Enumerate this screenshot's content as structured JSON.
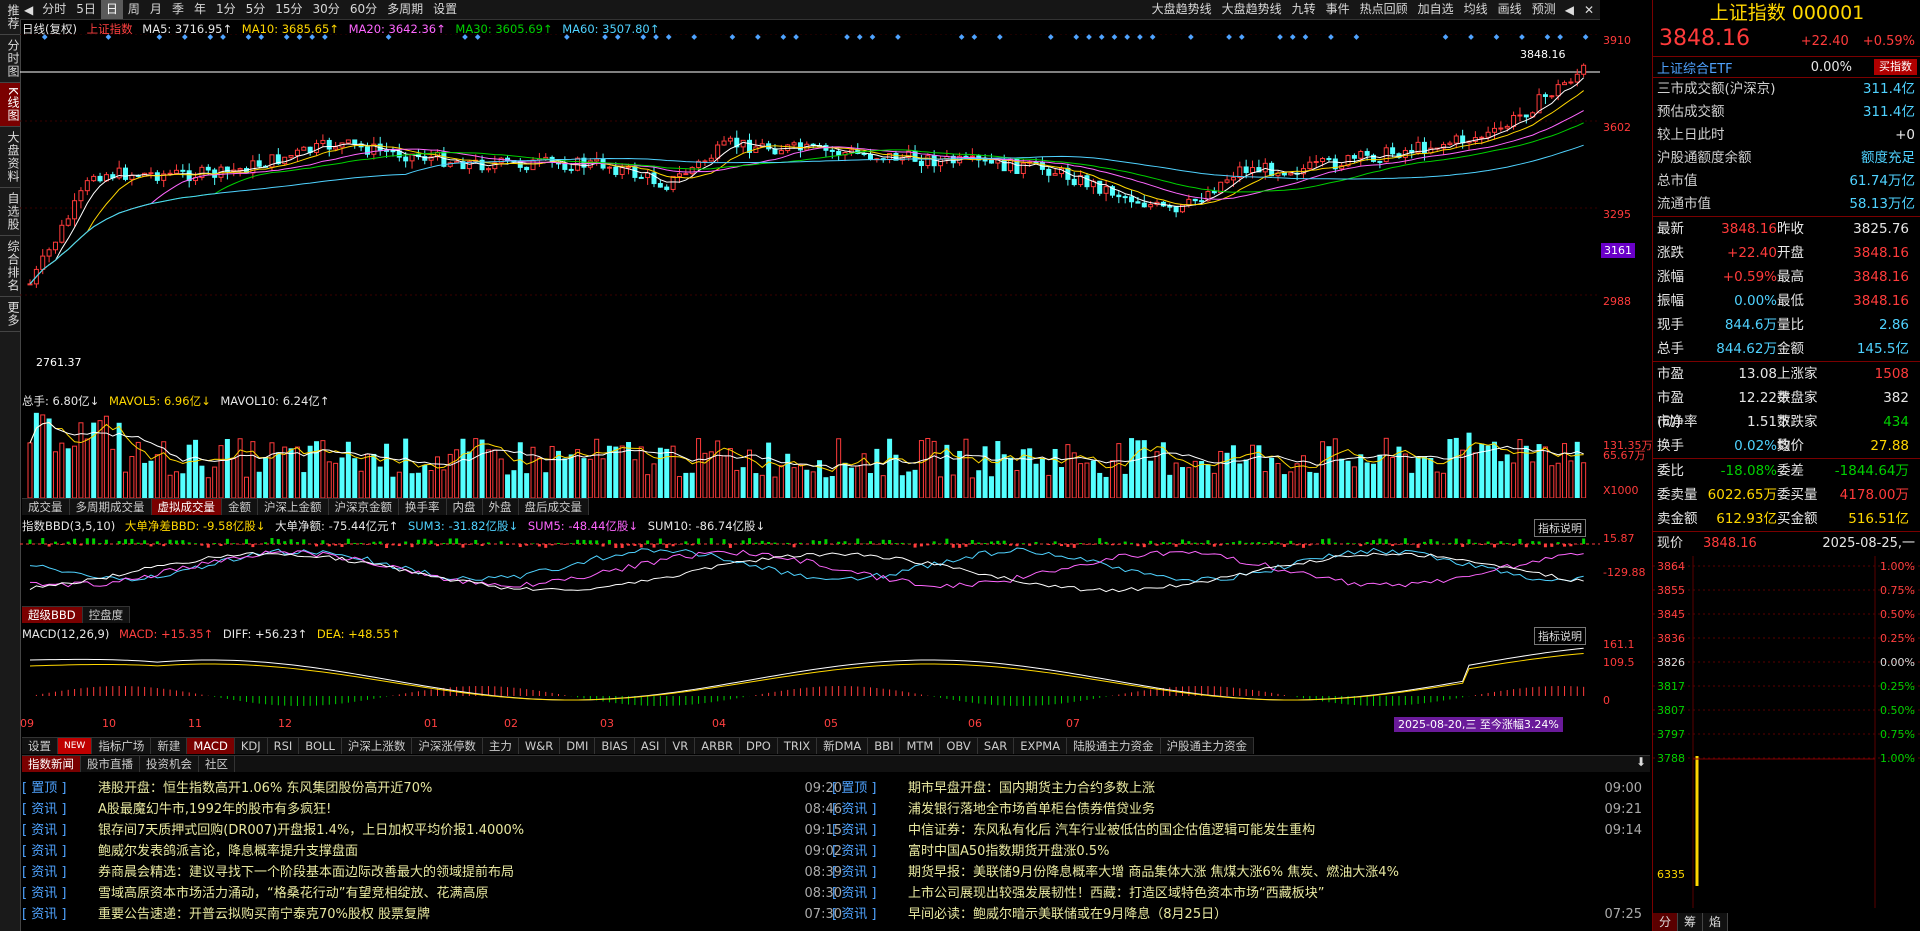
{
  "sidebar": {
    "tabs": [
      "推荐",
      "分时图",
      "K线图",
      "大盘资料",
      "自选股",
      "综合排名",
      "更多"
    ],
    "active": 2
  },
  "toolbar": {
    "left": [
      "分时",
      "5日",
      "日",
      "周",
      "月",
      "季",
      "年",
      "1分",
      "5分",
      "15分",
      "30分",
      "60分",
      "多周期",
      "设置"
    ],
    "selected": 2,
    "right": [
      "大盘趋势线",
      "大盘趋势线",
      "九转",
      "事件",
      "热点回顾",
      "加自选",
      "均线",
      "画线",
      "预测"
    ]
  },
  "kline": {
    "legend": {
      "title": "日线(复权)",
      "name": "上证指数",
      "ma5": "MA5: 3716.95↑",
      "ma10": "MA10: 3685.65↑",
      "ma20": "MA20: 3642.36↑",
      "ma30": "MA30: 3605.69↑",
      "ma60": "MA60: 3507.80↑"
    },
    "yticks": [
      "3910",
      "3602",
      "3295",
      "2988"
    ],
    "current_price_label": "3161",
    "high_label": "3848.16",
    "low_label": "2761.37"
  },
  "volume": {
    "legend": {
      "total": "总手: 6.80亿↓",
      "mavol5": "MAVOL5: 6.96亿↓",
      "mavol10": "MAVOL10: 6.24亿↑"
    },
    "yticks": [
      "131.35万",
      "65.67万"
    ],
    "unit": "X1000",
    "tabs": [
      "成交量",
      "多周期成交量",
      "虚拟成交量",
      "金额",
      "沪深上金额",
      "沪深京金额",
      "换手率",
      "内盘",
      "外盘",
      "盘后成交量"
    ],
    "selected": 2
  },
  "bbd": {
    "legend": {
      "title": "指数BBD(3,5,10)",
      "big": "大单净差BBD: -9.58亿股↓",
      "net": "大单净额: -75.44亿元↑",
      "sum3": "SUM3: -31.82亿股↓",
      "sum5": "SUM5: -48.44亿股↓",
      "sum10": "SUM10: -86.74亿股↓"
    },
    "yticks": [
      "15.87",
      "-129.88"
    ],
    "explain": "指标说明",
    "tabs": [
      "超级BBD",
      "控盘度"
    ],
    "selected": 0
  },
  "macd": {
    "legend": {
      "title": "MACD(12,26,9)",
      "macd": "MACD: +15.35↑",
      "diff": "DIFF: +56.23↑",
      "dea": "DEA: +48.55↑"
    },
    "yticks": [
      "161.1",
      "109.5",
      "0"
    ],
    "explain": "指标说明",
    "months": [
      "09",
      "10",
      "11",
      "12",
      "01",
      "02",
      "03",
      "04",
      "05",
      "06",
      "07"
    ],
    "range_label": "2025-08-20,三 至今涨幅3.24%"
  },
  "indicator_tabs": [
    "设置",
    "NEW",
    "指标广场",
    "新建",
    "MACD",
    "KDJ",
    "RSI",
    "BOLL",
    "沪深上涨数",
    "沪深涨停数",
    "主力",
    "W&R",
    "DMI",
    "BIAS",
    "ASI",
    "VR",
    "ARBR",
    "DPO",
    "TRIX",
    "新DMA",
    "BBI",
    "MTM",
    "OBV",
    "SAR",
    "EXPMA",
    "陆股通主力资金",
    "沪股通主力资金"
  ],
  "news": {
    "tabs": [
      "指数新闻",
      "股市直播",
      "投资机会",
      "社区"
    ],
    "left": [
      {
        "tag": "置顶",
        "title": "港股开盘：恒生指数高开1.06% 东风集团股份高开近70%",
        "time": "09:20"
      },
      {
        "tag": "资讯",
        "title": "A股最魔幻牛市,1992年的股市有多疯狂!",
        "time": "08:46"
      },
      {
        "tag": "资讯",
        "title": "银存间7天质押式回购(DR007)开盘报1.4%，上日加权平均价报1.4000%",
        "time": "09:15"
      },
      {
        "tag": "资讯",
        "title": "鲍威尔发表鸽派言论，降息概率提升支撑盘面",
        "time": "09:02"
      },
      {
        "tag": "资讯",
        "title": "券商晨会精选：建议寻找下一个阶段基本面边际改善最大的领域提前布局",
        "time": "08:39"
      },
      {
        "tag": "资讯",
        "title": "雪域高原资本市场活力涌动，“格桑花行动”有望竞相绽放、花满高原",
        "time": "08:30"
      },
      {
        "tag": "资讯",
        "title": "重要公告速递：开普云拟购买南宁泰克70%股权 股票复牌",
        "time": "07:30"
      }
    ],
    "right": [
      {
        "tag": "置顶",
        "title": "期市早盘开盘：国内期货主力合约多数上涨",
        "time": "09:00"
      },
      {
        "tag": "资讯",
        "title": "浦发银行落地全市场首单柜台债券借贷业务",
        "time": "09:21"
      },
      {
        "tag": "资讯",
        "title": "中信证券：东风私有化后 汽车行业被低估的国企估值逻辑可能发生重构",
        "time": "09:14"
      },
      {
        "tag": "资讯",
        "title": "富时中国A50指数期货开盘涨0.5%",
        "time": ""
      },
      {
        "tag": "资讯",
        "title": "期货早报：美联储9月份降息概率大增 商品集体大涨 焦煤大涨6% 焦炭、燃油大涨4%",
        "time": ""
      },
      {
        "tag": "资讯",
        "title": "上市公司展现出较强发展韧性！西藏：打造区域特色资本市场“西藏板块”",
        "time": ""
      },
      {
        "tag": "资讯",
        "title": "早间必读：鲍威尔暗示美联储或在9月降息（8月25日）",
        "time": "07:25"
      }
    ]
  },
  "quote": {
    "name": "上证指数 000001",
    "price": "3848.16",
    "change": "+22.40",
    "pct": "+0.59%",
    "etf": "上证综合ETF",
    "etf_pct": "0.00%",
    "buy_btn": "买指数",
    "rows1": [
      {
        "k": "三市成交额(沪深京)",
        "v": "311.4亿"
      },
      {
        "k": "预估成交额",
        "v": "311.4亿"
      },
      {
        "k": "较上日此时",
        "v": "+0"
      },
      {
        "k": "沪股通额度余额",
        "v": "额度充足"
      },
      {
        "k": "总市值",
        "v": "61.74万亿"
      },
      {
        "k": "流通市值",
        "v": "58.13万亿"
      }
    ],
    "rows2": [
      [
        "最新",
        "3848.16",
        "昨收",
        "3825.76"
      ],
      [
        "涨跌",
        "+22.40",
        "开盘",
        "3848.16"
      ],
      [
        "涨幅",
        "+0.59%",
        "最高",
        "3848.16"
      ],
      [
        "振幅",
        "0.00%",
        "最低",
        "3848.16"
      ],
      [
        "现手",
        "844.6万",
        "量比",
        "2.86"
      ],
      [
        "总手",
        "844.62万",
        "金额",
        "145.5亿"
      ]
    ],
    "rows3": [
      [
        "市盈",
        "13.08",
        "上涨家数",
        "1508"
      ],
      [
        "市盈(动)",
        "12.22",
        "平盘家数",
        "382"
      ],
      [
        "市净率",
        "1.51",
        "下跌家数",
        "434"
      ],
      [
        "换手",
        "0.02%",
        "均价",
        "27.88"
      ]
    ],
    "rows4": [
      [
        "委比",
        "-18.08%",
        "委差",
        "-1844.64万"
      ],
      [
        "委卖量",
        "6022.65万",
        "委买量",
        "4178.00万"
      ],
      [
        "卖金额",
        "612.93亿",
        "买金额",
        "516.51亿"
      ]
    ],
    "now_label": "现价",
    "now_val": "3848.16",
    "date": "2025-08-25,一",
    "mini_left": [
      "3864",
      "3855",
      "3845",
      "3836",
      "3826",
      "3817",
      "3807",
      "3797",
      "3788",
      "6335"
    ],
    "mini_right": [
      "1.00%",
      "0.75%",
      "0.50%",
      "0.25%",
      "0.00%",
      "0.25%",
      "0.50%",
      "0.75%",
      "1.00%"
    ],
    "bottom_tabs": [
      "分",
      "筹",
      "焰"
    ]
  }
}
